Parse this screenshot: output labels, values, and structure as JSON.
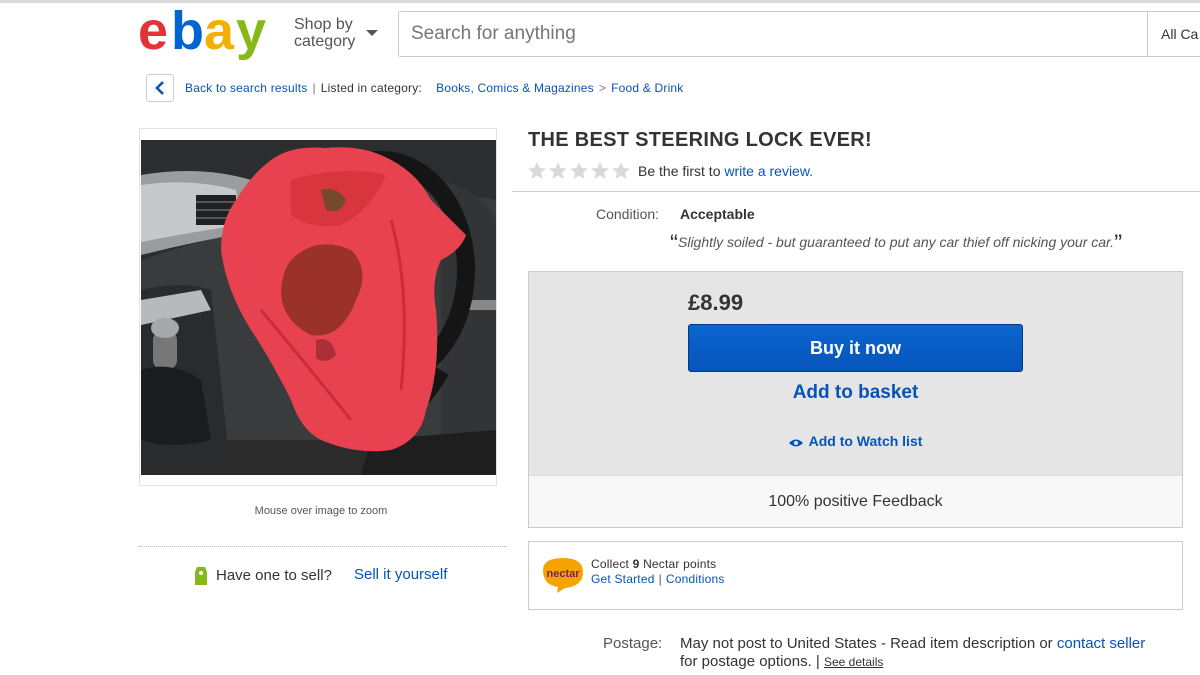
{
  "header": {
    "logo_letters": [
      "e",
      "b",
      "a",
      "y"
    ],
    "logo_colors": [
      "#e53238",
      "#0064d2",
      "#f5af02",
      "#86b817"
    ],
    "shop_by_line1": "Shop by",
    "shop_by_line2": "category",
    "search_placeholder": "Search for anything",
    "search_category": "All Ca"
  },
  "breadcrumb": {
    "back": "Back to search results",
    "listed_in": "Listed in category:",
    "category1": "Books, Comics & Magazines",
    "arrow": ">",
    "category2": "Food & Drink"
  },
  "image": {
    "zoom_hint": "Mouse over image to zoom"
  },
  "sell": {
    "question": "Have one to sell?",
    "link": "Sell it yourself"
  },
  "item": {
    "title": "THE BEST STEERING LOCK EVER!",
    "rating_stars": 0,
    "review_prefix": "Be the first to",
    "review_link": "write a review.",
    "condition_label": "Condition:",
    "condition_value": "Acceptable",
    "condition_description": "Slightly soiled - but guaranteed to put any car thief off nicking your car."
  },
  "buybox": {
    "price": "£8.99",
    "buy_now": "Buy it now",
    "add_to_basket": "Add to basket",
    "watch_list": "Add to Watch list",
    "feedback": "100% positive Feedback"
  },
  "nectar": {
    "logo_text": "nectar",
    "collect_prefix": "Collect",
    "points": "9",
    "collect_suffix": "Nectar points",
    "get_started": "Get Started",
    "conditions": "Conditions"
  },
  "postage": {
    "label": "Postage:",
    "text": "May not post to United States - Read item description or",
    "contact_link": "contact seller",
    "text2": "for postage options. |",
    "see_details": "See details"
  },
  "colors": {
    "link_blue": "#0654ba",
    "buy_button": "#0654ba",
    "star_grey": "#d9d9d9",
    "tag_green": "#86b817",
    "nectar_orange": "#f5a300"
  }
}
